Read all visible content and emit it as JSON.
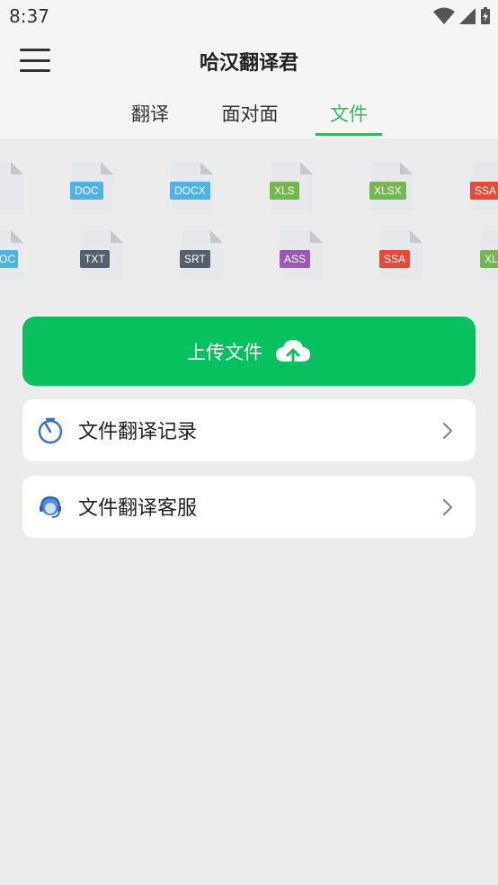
{
  "status_bar": {
    "time": "8:37"
  },
  "header": {
    "title": "哈汉翻译君",
    "tabs": [
      {
        "label": "翻译"
      },
      {
        "label": "面对面"
      },
      {
        "label": "文件"
      }
    ],
    "active_tab": 2
  },
  "file_types": {
    "row1": [
      {
        "label": "",
        "color": "#55606e"
      },
      {
        "label": "DOC",
        "color": "#4fb3e2"
      },
      {
        "label": "DOCX",
        "color": "#4fb3e2"
      },
      {
        "label": "XLS",
        "color": "#74b652"
      },
      {
        "label": "XLSX",
        "color": "#74b652"
      },
      {
        "label": "SSA",
        "color": "#e84a3a"
      }
    ],
    "row2": [
      {
        "label": "OC",
        "color": "#4fb3e2"
      },
      {
        "label": "TXT",
        "color": "#55606e"
      },
      {
        "label": "SRT",
        "color": "#55606e"
      },
      {
        "label": "ASS",
        "color": "#9b59b6"
      },
      {
        "label": "SSA",
        "color": "#e84a3a"
      },
      {
        "label": "XL",
        "color": "#74b652"
      }
    ]
  },
  "upload": {
    "label": "上传文件",
    "color": "#07c160"
  },
  "menu_items": [
    {
      "label": "文件翻译记录",
      "icon": "history-clock-icon"
    },
    {
      "label": "文件翻译客服",
      "icon": "customer-service-icon"
    }
  ],
  "colors": {
    "accent": "#3cb362",
    "primary_button": "#07c160"
  }
}
